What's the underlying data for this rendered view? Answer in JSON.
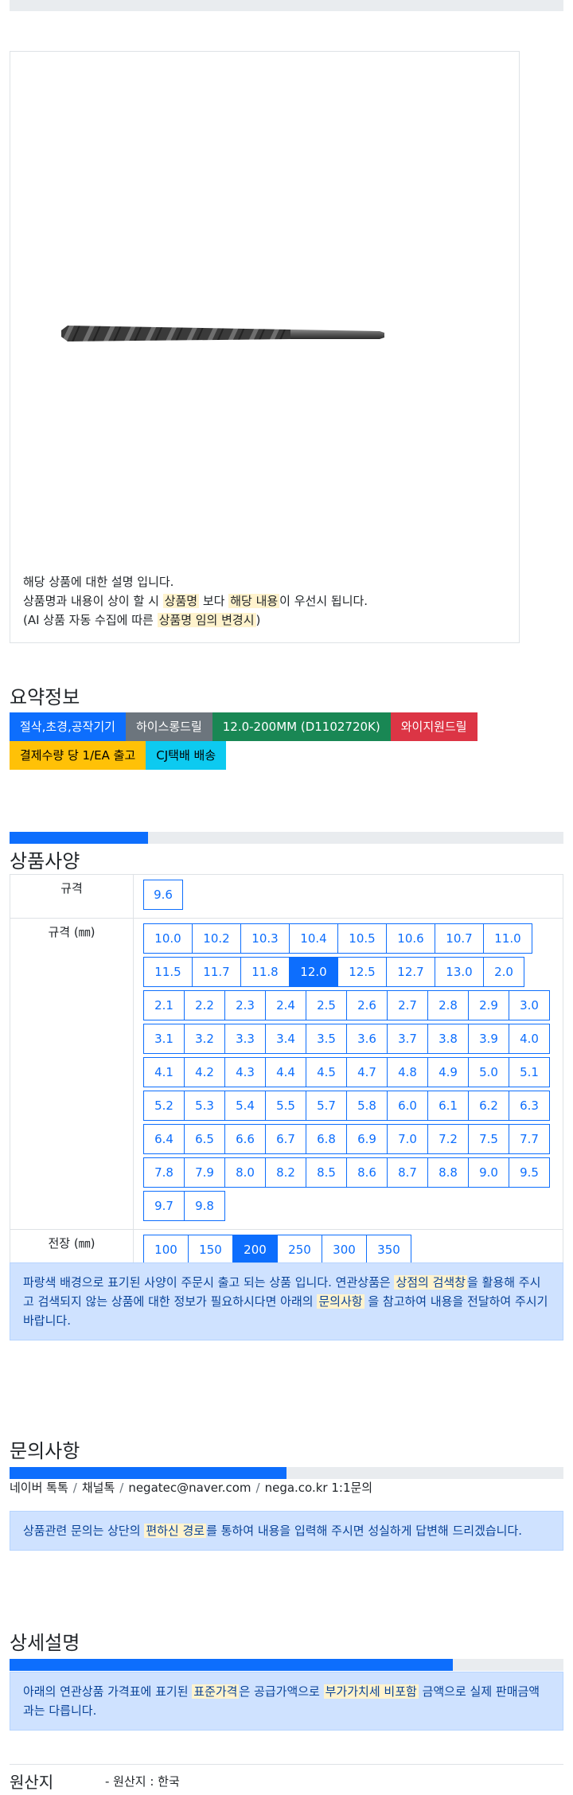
{
  "notice": {
    "line1": "해당 상품에 대한 설명 입니다.",
    "line2_a": "상품명과 내용이 상이 할 시 ",
    "line2_hl1": "상품명",
    "line2_b": " 보다 ",
    "line2_hl2": "해당 내용",
    "line2_c": "이 우선시 됩니다.",
    "line3_a": "(AI 상품 자동 수집에 따른 ",
    "line3_hl": "상품명 임의 변경시",
    "line3_b": ")"
  },
  "summary": {
    "title": "요약정보",
    "badges": [
      {
        "label": "절삭,초경,공작기기",
        "color": "#0d6efd",
        "text_color": "#ffffff"
      },
      {
        "label": "하이스롱드릴",
        "color": "#6c757d",
        "text_color": "#ffffff"
      },
      {
        "label": "12.0-200MM (D1102720K)",
        "color": "#198754",
        "text_color": "#ffffff"
      },
      {
        "label": "와이지원드릴",
        "color": "#dc3545",
        "text_color": "#ffffff"
      },
      {
        "label": "결제수량 당 1/EA 출고",
        "color": "#ffc107",
        "text_color": "#000000"
      },
      {
        "label": "CJ택배 배송",
        "color": "#0dcaf0",
        "text_color": "#000000"
      }
    ]
  },
  "spec": {
    "title": "상품사양",
    "progress": 0.25,
    "rows": [
      {
        "label": "규격",
        "options": [
          "9.6"
        ],
        "selected": ""
      },
      {
        "label": "규격 (㎜)",
        "options": [
          "10.0",
          "10.2",
          "10.3",
          "10.4",
          "10.5",
          "10.6",
          "10.7",
          "11.0",
          "11.5",
          "11.7",
          "11.8",
          "12.0",
          "12.5",
          "12.7",
          "13.0",
          "2.0",
          "2.1",
          "2.2",
          "2.3",
          "2.4",
          "2.5",
          "2.6",
          "2.7",
          "2.8",
          "2.9",
          "3.0",
          "3.1",
          "3.2",
          "3.3",
          "3.4",
          "3.5",
          "3.6",
          "3.7",
          "3.8",
          "3.9",
          "4.0",
          "4.1",
          "4.2",
          "4.3",
          "4.4",
          "4.5",
          "4.7",
          "4.8",
          "4.9",
          "5.0",
          "5.1",
          "5.2",
          "5.3",
          "5.4",
          "5.5",
          "5.7",
          "5.8",
          "6.0",
          "6.1",
          "6.2",
          "6.3",
          "6.4",
          "6.5",
          "6.6",
          "6.7",
          "6.8",
          "6.9",
          "7.0",
          "7.2",
          "7.5",
          "7.7",
          "7.8",
          "7.9",
          "8.0",
          "8.2",
          "8.5",
          "8.6",
          "8.7",
          "8.8",
          "9.0",
          "9.5",
          "9.7",
          "9.8"
        ],
        "selected": "12.0"
      },
      {
        "label": "전장 (㎜)",
        "options": [
          "100",
          "150",
          "200",
          "250",
          "300",
          "350"
        ],
        "selected": "200"
      }
    ],
    "info_a": "파랑색 배경으로 표기된 사양이 주문시 출고 되는 상품 입니다. 연관상품은 ",
    "info_hl1": "상점의 검색창",
    "info_b": "을 활용해 주시고 검색되지 않는 상품에 대한 정보가 필요하시다면 아래의 ",
    "info_hl2": "문의사항",
    "info_c": " 을 참고하여 내용을 전달하여 주시기 바랍니다."
  },
  "inquiry": {
    "title": "문의사항",
    "progress": 0.5,
    "contacts": [
      "네이버 톡톡",
      "채널톡",
      "negatec@naver.com",
      "nega.co.kr 1:1문의"
    ],
    "separator": "/",
    "info_a": "상품관련 문의는 상단의 ",
    "info_hl": "편하신 경로",
    "info_b": "를 통하여 내용을 입력해 주시면 성실하게 답변해 드리겠습니다."
  },
  "detail": {
    "title": "상세설명",
    "progress": 0.8,
    "info_a": "아래의 연관상품 가격표에 표기된 ",
    "info_hl1": "표준가격",
    "info_b": "은 공급가액으로 ",
    "info_hl2": "부가가치세 비포함",
    "info_c": " 금액으로 실제 판매금액과는 다릅니다.",
    "origin_label": "원산지",
    "origin_value": "- 원산지 : 한국"
  }
}
